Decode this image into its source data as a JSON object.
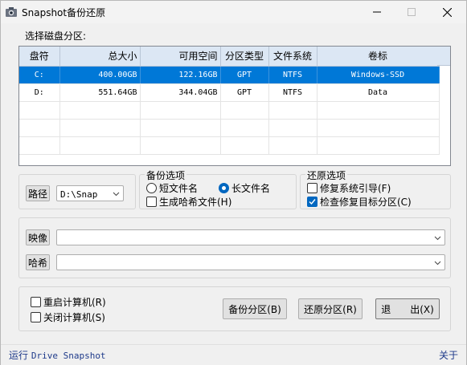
{
  "window": {
    "title": "Snapshot备份还原",
    "app_icon": "app-icon"
  },
  "disk_section": {
    "label": "选择磁盘分区:",
    "columns": [
      "盘符",
      "总大小",
      "可用空间",
      "分区类型",
      "文件系统",
      "卷标"
    ],
    "rows": [
      {
        "drive": "C:",
        "total": "400.00GB",
        "free": "122.16GB",
        "type": "GPT",
        "fs": "NTFS",
        "volume": "Windows-SSD",
        "selected": true
      },
      {
        "drive": "D:",
        "total": "551.64GB",
        "free": "344.04GB",
        "type": "GPT",
        "fs": "NTFS",
        "volume": "Data",
        "selected": false
      }
    ]
  },
  "path": {
    "button": "路径",
    "value": "D:\\Snap"
  },
  "backup_options": {
    "legend": "备份选项",
    "short_name": "短文件名",
    "long_name": "长文件名",
    "long_selected": true,
    "hash_file": "生成哈希文件(H)",
    "hash_checked": false
  },
  "restore_options": {
    "legend": "还原选项",
    "fix_boot": "修复系统引导(F)",
    "fix_boot_checked": false,
    "check_target": "检查修复目标分区(C)",
    "check_target_checked": true
  },
  "image": {
    "button": "映像",
    "value": ""
  },
  "hash": {
    "button": "哈希",
    "value": ""
  },
  "after": {
    "reboot": "重启计算机(R)",
    "shutdown": "关闭计算机(S)"
  },
  "actions": {
    "backup": "备份分区(B)",
    "restore": "还原分区(R)",
    "exit": "退　　出(X)"
  },
  "status": {
    "run_prefix": "运行",
    "run_name": "Drive Snapshot",
    "about": "关于"
  }
}
